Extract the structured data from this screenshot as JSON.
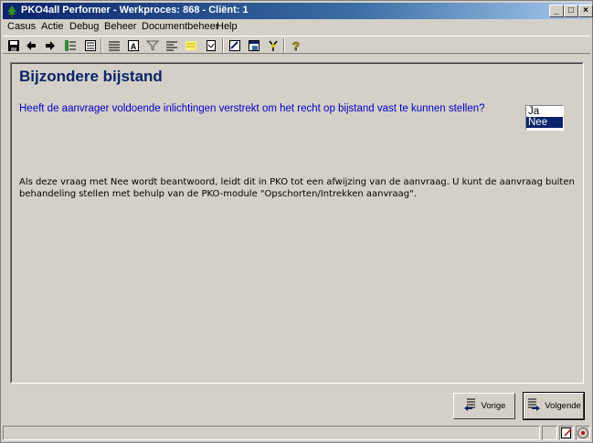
{
  "window": {
    "title": "PKO4all Performer - Werkproces: 868 - Cliënt: 1",
    "controls": {
      "minimize": "_",
      "maximize": "□",
      "close": "×"
    }
  },
  "menu": {
    "items": [
      {
        "label": "Casus"
      },
      {
        "label": "Actie"
      },
      {
        "label": "Debug"
      },
      {
        "label": "Beheer"
      },
      {
        "label": "Documentbeheer"
      },
      {
        "label": "Help"
      }
    ]
  },
  "toolbar": {
    "icons": [
      "save-icon",
      "back-arrow-icon",
      "forward-arrow-icon",
      "tree-icon",
      "list-icon",
      "details-icon",
      "text-icon",
      "funnel-icon",
      "align-icon",
      "note-icon",
      "document-icon",
      "form-icon",
      "window-icon",
      "branch-icon",
      "help-icon"
    ]
  },
  "main": {
    "title": "Bijzondere bijstand",
    "question": "Heeft de aanvrager voldoende inlichtingen verstrekt om het recht op bijstand vast te kunnen stellen?",
    "options": [
      "Ja",
      "Nee"
    ],
    "selected": "Nee",
    "info": "Als deze vraag met Nee wordt beantwoord, leidt dit in PKO tot een afwijzing van de aanvraag. U kunt de aanvraag buiten behandeling stellen met behulp van de PKO-module \"Opschorten/Intrekken aanvraag\"."
  },
  "buttons": {
    "previous": "Vorige",
    "next": "Volgende"
  },
  "colors": {
    "titlebar": "#0a246a",
    "heading": "#0a246a",
    "question": "#0000c8",
    "face": "#d4d0c8"
  }
}
